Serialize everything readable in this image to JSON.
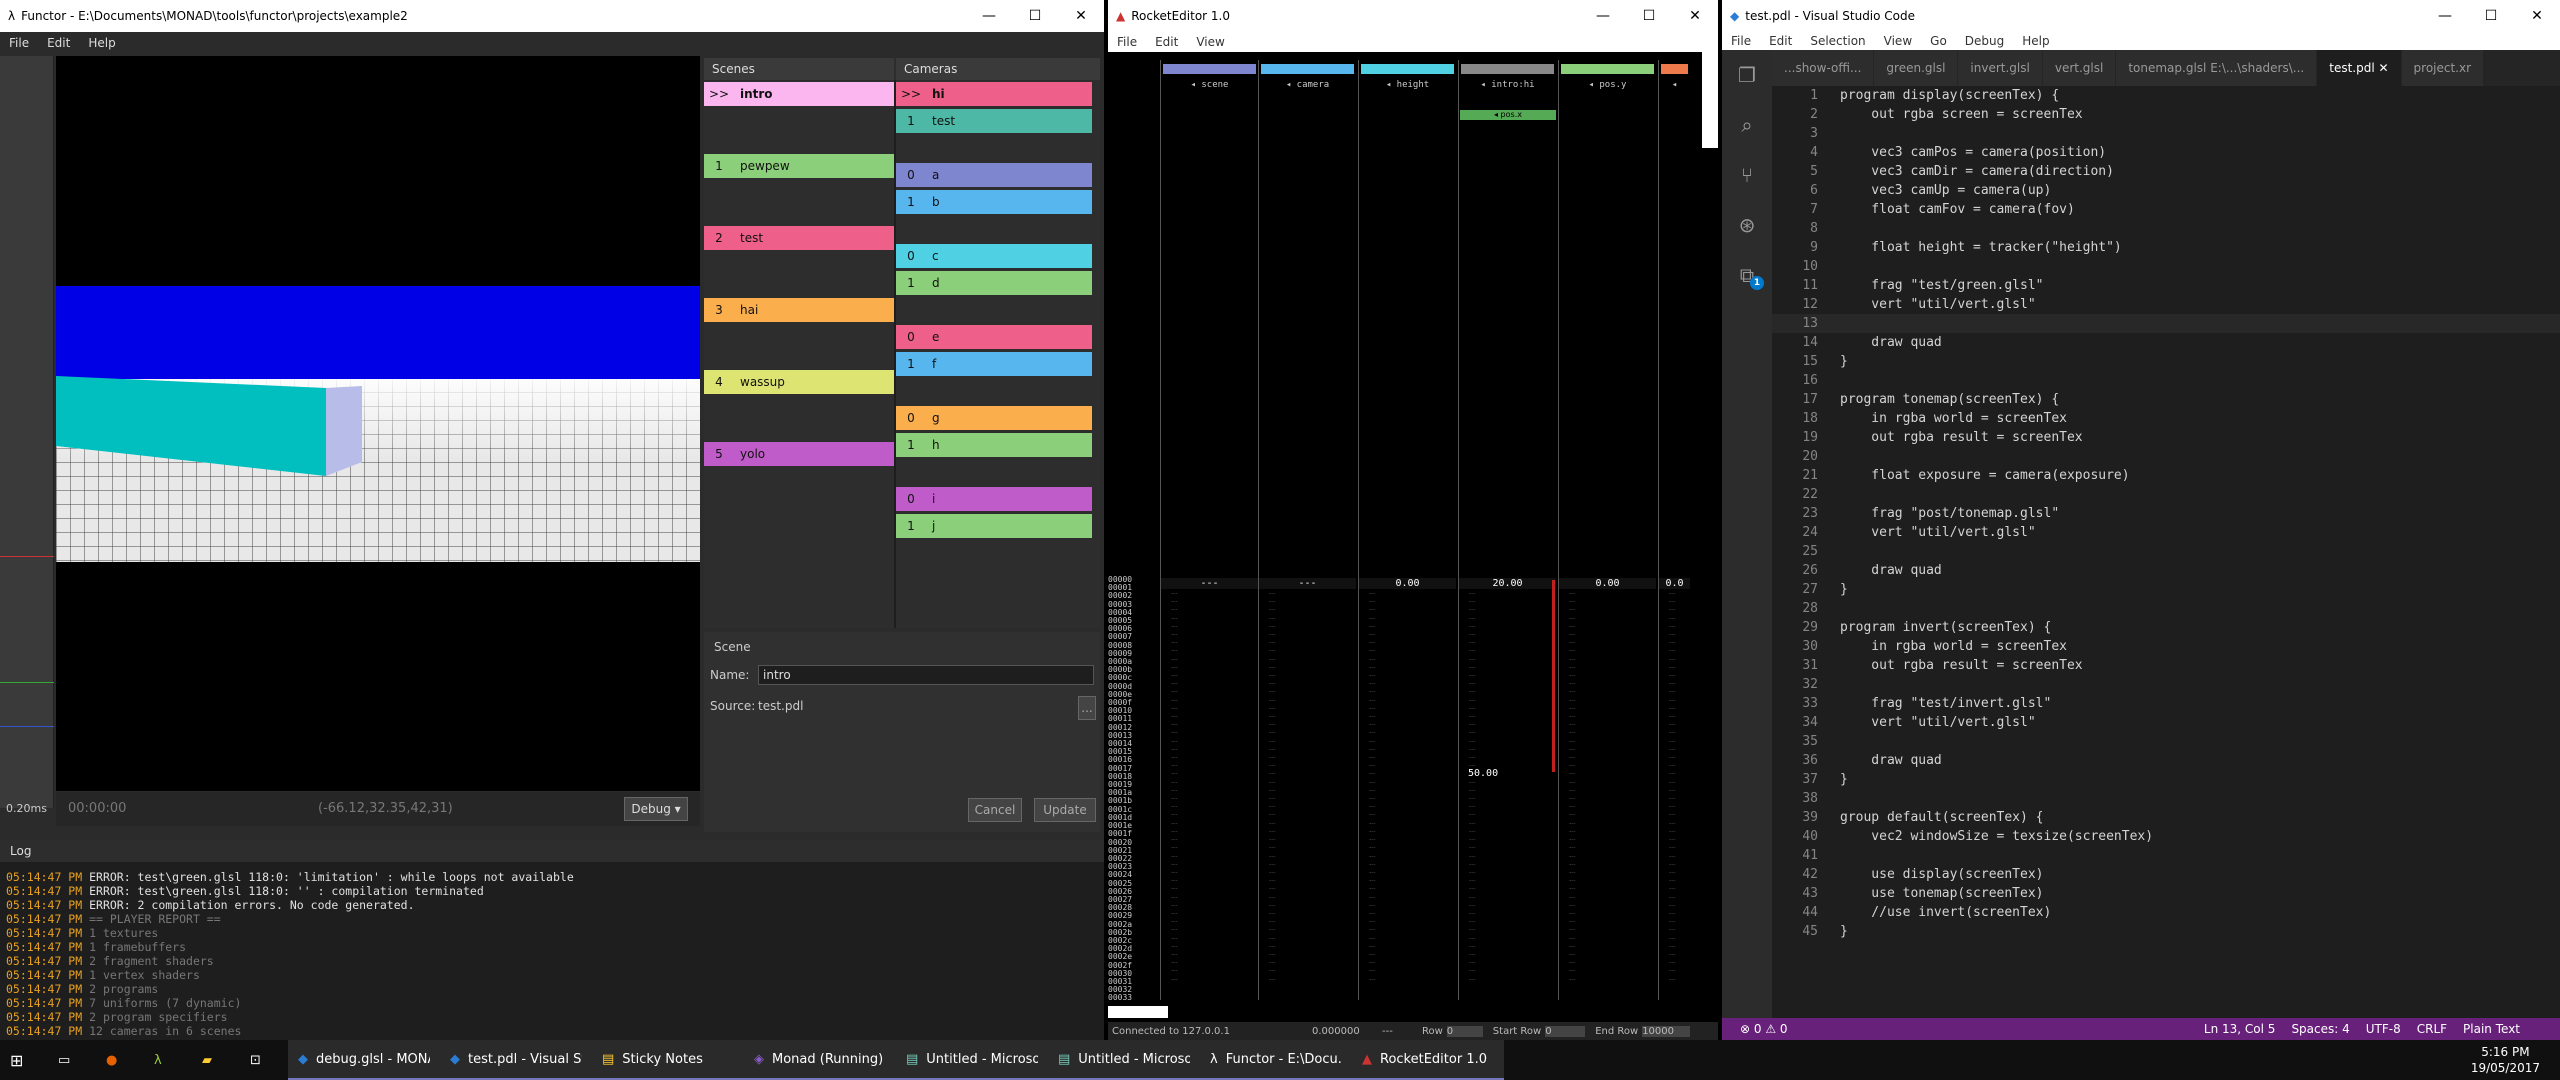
{
  "functor": {
    "title": "Functor - E:\\Documents\\MONAD\\tools\\functor\\projects\\example2",
    "menu": [
      "File",
      "Edit",
      "Help"
    ],
    "time_ms": "0.20ms",
    "timecode": "00:00:00",
    "coords": "(-66.12,32.35,42,31)",
    "debug_label": "Debug",
    "scenes_header": "Scenes",
    "cameras_header": "Cameras",
    "scenes": [
      {
        "n": ">>",
        "label": "intro",
        "color": "#fbb6f0"
      },
      {
        "n": "1",
        "label": "pewpew",
        "color": "#8ccf7a"
      },
      {
        "n": "2",
        "label": "test",
        "color": "#ee5f8a"
      },
      {
        "n": "3",
        "label": "hai",
        "color": "#fbae4c"
      },
      {
        "n": "4",
        "label": "wassup",
        "color": "#dde472"
      },
      {
        "n": "5",
        "label": "yolo",
        "color": "#c05cc9"
      }
    ],
    "cameras": [
      {
        "n": ">>",
        "label": "hi",
        "color": "#ee5f8a"
      },
      {
        "n": "1",
        "label": "test",
        "color": "#4db8a6"
      },
      {
        "n": "0",
        "label": "a",
        "color": "#7e86d0"
      },
      {
        "n": "1",
        "label": "b",
        "color": "#58b6ef"
      },
      {
        "n": "0",
        "label": "c",
        "color": "#4fd0e3"
      },
      {
        "n": "1",
        "label": "d",
        "color": "#8ccf7a"
      },
      {
        "n": "0",
        "label": "e",
        "color": "#ee5f8a"
      },
      {
        "n": "1",
        "label": "f",
        "color": "#58b6ef"
      },
      {
        "n": "0",
        "label": "g",
        "color": "#fbae4c"
      },
      {
        "n": "1",
        "label": "h",
        "color": "#8ccf7a"
      },
      {
        "n": "0",
        "label": "i",
        "color": "#c05cc9"
      },
      {
        "n": "1",
        "label": "j",
        "color": "#8ccf7a"
      }
    ],
    "scene_panel": {
      "header": "Scene",
      "name_label": "Name:",
      "name_value": "intro",
      "source_label": "Source:",
      "source_value": "test.pdl",
      "browse": "...",
      "cancel": "Cancel",
      "update": "Update"
    },
    "log_header": "Log",
    "log": [
      {
        "t": "05:14:47 PM ERROR: test\\green.glsl 118:0: 'limitation' : while loops not available",
        "c": "#e0e0e0"
      },
      {
        "t": "05:14:47 PM ERROR: test\\green.glsl 118:0: '' : compilation terminated",
        "c": "#e0e0e0"
      },
      {
        "t": "05:14:47 PM ERROR: 2 compilation errors.  No code generated.",
        "c": "#e0e0e0"
      },
      {
        "t": "05:14:47 PM == PLAYER REPORT ==",
        "c": "#777"
      },
      {
        "t": "05:14:47 PM 1 textures",
        "c": "#777"
      },
      {
        "t": "05:14:47 PM 1 framebuffers",
        "c": "#777"
      },
      {
        "t": "05:14:47 PM 2 fragment shaders",
        "c": "#777"
      },
      {
        "t": "05:14:47 PM 1 vertex shaders",
        "c": "#777"
      },
      {
        "t": "05:14:47 PM 2 programs",
        "c": "#777"
      },
      {
        "t": "05:14:47 PM 7 uniforms (7 dynamic)",
        "c": "#777"
      },
      {
        "t": "05:14:47 PM 2 program specifiers",
        "c": "#777"
      },
      {
        "t": "05:14:47 PM 12 cameras in 6 scenes",
        "c": "#777"
      }
    ]
  },
  "rocket": {
    "title": "RocketEditor 1.0",
    "menu": [
      "File",
      "Edit",
      "View"
    ],
    "tracks": [
      {
        "name": "scene",
        "color": "#7e86d0",
        "val": "---"
      },
      {
        "name": "camera",
        "color": "#58b6ef",
        "val": "---"
      },
      {
        "name": "height",
        "color": "#4fd0e3",
        "val": "0.00"
      },
      {
        "name": "intro:hi",
        "color": "#888",
        "val": "20.00"
      },
      {
        "name": "pos.y",
        "color": "#8ccf7a",
        "val": "0.00"
      },
      {
        "name": "",
        "color": "#ee7a4c",
        "val": "0.0"
      }
    ],
    "subtrack": "pos.x",
    "key_val": "50.00",
    "status": {
      "connected": "Connected to 127.0.0.1",
      "value": "0.000000",
      "dash": "---",
      "row_label": "Row",
      "row": "0",
      "start_label": "Start Row",
      "start": "0",
      "end_label": "End Row",
      "end": "10000"
    }
  },
  "vscode": {
    "title": "test.pdl - Visual Studio Code",
    "menu": [
      "File",
      "Edit",
      "Selection",
      "View",
      "Go",
      "Debug",
      "Help"
    ],
    "tabs": [
      "...show-offi...",
      "green.glsl",
      "invert.glsl",
      "vert.glsl",
      "tonemap.glsl  E:\\...\\shaders\\...",
      "test.pdl",
      "project.xr"
    ],
    "badge": "1",
    "code": [
      "program display(screenTex) {",
      "    out rgba screen = screenTex",
      "",
      "    vec3 camPos = camera(position)",
      "    vec3 camDir = camera(direction)",
      "    vec3 camUp = camera(up)",
      "    float camFov = camera(fov)",
      "",
      "    float height = tracker(\"height\")",
      "",
      "    frag \"test/green.glsl\"",
      "    vert \"util/vert.glsl\"",
      "",
      "    draw quad",
      "}",
      "",
      "program tonemap(screenTex) {",
      "    in rgba world = screenTex",
      "    out rgba result = screenTex",
      "",
      "    float exposure = camera(exposure)",
      "",
      "    frag \"post/tonemap.glsl\"",
      "    vert \"util/vert.glsl\"",
      "",
      "    draw quad",
      "}",
      "",
      "program invert(screenTex) {",
      "    in rgba world = screenTex",
      "    out rgba result = screenTex",
      "",
      "    frag \"test/invert.glsl\"",
      "    vert \"util/vert.glsl\"",
      "",
      "    draw quad",
      "}",
      "",
      "group default(screenTex) {",
      "    vec2 windowSize = texsize(screenTex)",
      "",
      "    use display(screenTex)",
      "    use tonemap(screenTex)",
      "    //use invert(screenTex)",
      "}"
    ],
    "status": {
      "problems": "⊗ 0  ⚠ 0",
      "pos": "Ln 13, Col 5",
      "spaces": "Spaces: 4",
      "enc": "UTF-8",
      "eol": "CRLF",
      "lang": "Plain Text"
    }
  },
  "taskbar": {
    "items": [
      "debug.glsl - MONA...",
      "test.pdl - Visual Stu...",
      "Sticky Notes",
      "Monad (Running) -...",
      "Untitled - Microsof...",
      "Untitled - Microsof...",
      "Functor - E:\\Docu...",
      "RocketEditor 1.0"
    ],
    "time": "5:16 PM",
    "date": "19/05/2017"
  }
}
